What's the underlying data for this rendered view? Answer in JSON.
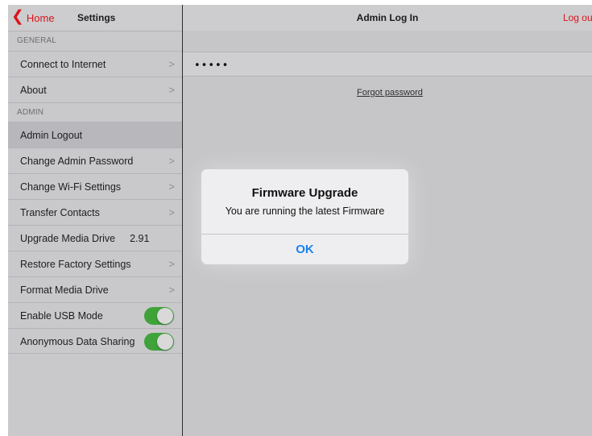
{
  "colors": {
    "accent_red": "#d8161a",
    "toggle_on": "#3fa33a",
    "alert_button": "#1a82f5"
  },
  "sidebar": {
    "back_label": "Home",
    "back_icon": "chevron-left-icon",
    "title": "Settings",
    "general_header": "GENERAL",
    "admin_header": "ADMIN",
    "general_items": [
      {
        "label": "Connect to Internet"
      },
      {
        "label": "About"
      }
    ],
    "admin_items": [
      {
        "label": "Admin Logout"
      },
      {
        "label": "Change Admin Password"
      },
      {
        "label": "Change Wi-Fi Settings"
      },
      {
        "label": "Transfer Contacts"
      },
      {
        "label": "Upgrade Media Drive",
        "value": "2.91"
      },
      {
        "label": "Restore Factory Settings"
      },
      {
        "label": "Format Media Drive"
      },
      {
        "label": "Enable USB Mode",
        "toggle": true
      },
      {
        "label": "Anonymous Data Sharing",
        "toggle": true
      }
    ]
  },
  "main": {
    "title": "Admin Log In",
    "logout_label": "Log out",
    "password_value": "•••••",
    "forgot_label": "Forgot password"
  },
  "alert": {
    "title": "Firmware Upgrade",
    "message": "You are running the latest Firmware",
    "ok_label": "OK"
  }
}
